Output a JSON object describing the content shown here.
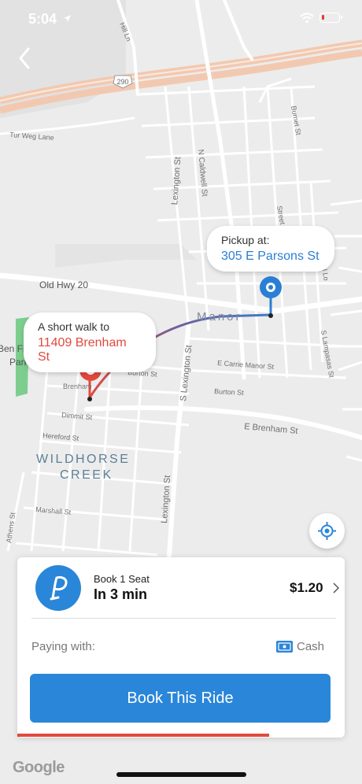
{
  "status_bar": {
    "time": "5:04"
  },
  "map": {
    "highway_shield": "290",
    "streets": [
      {
        "id": "tur-weg",
        "text": "Tur Weg Lane"
      },
      {
        "id": "hill-ln",
        "text": "Hill Ln"
      },
      {
        "id": "old-hwy-20",
        "text": "Old Hwy 20"
      },
      {
        "id": "manor",
        "text": "Manor"
      },
      {
        "id": "n-caldwell",
        "text": "N Caldwell St"
      },
      {
        "id": "lexington-n",
        "text": "Lexington St"
      },
      {
        "id": "burnet",
        "text": "Burnet St"
      },
      {
        "id": "street",
        "text": "Street"
      },
      {
        "id": "n-lo",
        "text": "N Lo"
      },
      {
        "id": "burton1",
        "text": "Burton St"
      },
      {
        "id": "brenham-w",
        "text": "Brenham"
      },
      {
        "id": "dimmit",
        "text": "Dimmit St"
      },
      {
        "id": "hereford",
        "text": "Hereford St"
      },
      {
        "id": "marshall",
        "text": "Marshall St"
      },
      {
        "id": "athens",
        "text": "Athens St"
      },
      {
        "id": "s-lexington",
        "text": "S Lexington St"
      },
      {
        "id": "lexington-s",
        "text": "Lexington St"
      },
      {
        "id": "e-carrie",
        "text": "E Carrie Manor St"
      },
      {
        "id": "burton2",
        "text": "Burton St"
      },
      {
        "id": "e-brenham",
        "text": "E Brenham St"
      },
      {
        "id": "s-lampasas",
        "text": "S Lampasas St"
      },
      {
        "id": "ben-fie",
        "text": "Ben Fie"
      },
      {
        "id": "park",
        "text": "Park"
      },
      {
        "id": "wildhorse",
        "text": "WILDHORSE"
      },
      {
        "id": "creek",
        "text": "CREEK"
      }
    ]
  },
  "pickup_callout": {
    "label": "Pickup at:",
    "address": "305 E Parsons St"
  },
  "walk_callout": {
    "label": "A short walk to",
    "address": "11409 Brenham St"
  },
  "ride_card": {
    "book_seat": "Book 1 Seat",
    "eta": "In 3 min",
    "price": "$1.20",
    "paying_label": "Paying with:",
    "payment_method": "Cash",
    "book_button": "Book This Ride",
    "progress_fraction": 0.77
  },
  "branding": {
    "google": "Google"
  },
  "icons": {
    "back": "chevron-left-icon",
    "recenter": "crosshair-icon",
    "logo": "p-logo-icon",
    "cash": "cash-icon"
  },
  "colors": {
    "accent": "#2a86d8",
    "walk": "#e2493f",
    "route": "#3c7ec9"
  }
}
